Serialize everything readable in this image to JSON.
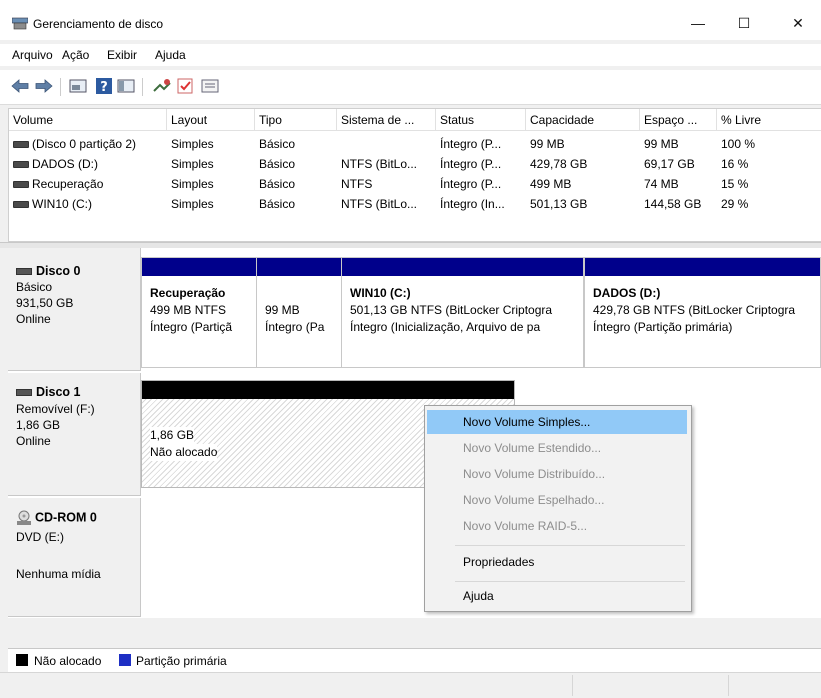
{
  "window": {
    "title": "Gerenciamento de disco",
    "minimize_glyph": "—",
    "maximize_glyph": "☐",
    "close_glyph": "✕"
  },
  "menu": [
    "Arquivo",
    "Ação",
    "Exibir",
    "Ajuda"
  ],
  "toolbar": {
    "icons": [
      "back-arrow-icon",
      "forward-arrow-icon",
      "disk-list-icon",
      "help-icon",
      "console-tree-icon",
      "connect-icon",
      "check-icon",
      "properties-icon"
    ]
  },
  "volume_table": {
    "columns": [
      "Volume",
      "Layout",
      "Tipo",
      "Sistema de ...",
      "Status",
      "Capacidade",
      "Espaço ...",
      "% Livre"
    ],
    "rows": [
      [
        "(Disco 0 partição 2)",
        "Simples",
        "Básico",
        "",
        "Íntegro (P...",
        "99 MB",
        "99 MB",
        "100 %"
      ],
      [
        "DADOS (D:)",
        "Simples",
        "Básico",
        "NTFS (BitLo...",
        "Íntegro (P...",
        "429,78 GB",
        "69,17 GB",
        "16 %"
      ],
      [
        "Recuperação",
        "Simples",
        "Básico",
        "NTFS",
        "Íntegro (P...",
        "499 MB",
        "74 MB",
        "15 %"
      ],
      [
        "WIN10 (C:)",
        "Simples",
        "Básico",
        "NTFS (BitLo...",
        "Íntegro (In...",
        "501,13 GB",
        "144,58 GB",
        "29 %"
      ]
    ]
  },
  "disk0": {
    "name": "Disco 0",
    "type": "Básico",
    "size": "931,50 GB",
    "status": "Online",
    "partitions": [
      {
        "title": "Recuperação",
        "line1": "499 MB NTFS",
        "line2": "Íntegro (Partiçã"
      },
      {
        "title": "",
        "line1": "99 MB",
        "line2": "Íntegro (Pa"
      },
      {
        "title": "WIN10  (C:)",
        "line1": "501,13 GB NTFS (BitLocker Criptogra",
        "line2": "Íntegro (Inicialização, Arquivo de pa"
      },
      {
        "title": "DADOS  (D:)",
        "line1": "429,78 GB NTFS (BitLocker Criptogra",
        "line2": "Íntegro (Partição primária)"
      }
    ]
  },
  "disk1": {
    "name": "Disco 1",
    "type": "Removível (F:)",
    "size": "1,86 GB",
    "status": "Online",
    "unallocated": {
      "line1": "1,86 GB",
      "line2": "Não alocado"
    }
  },
  "cdrom": {
    "name": "CD-ROM 0",
    "type": "DVD (E:)",
    "status": "Nenhuma mídia"
  },
  "context_menu": [
    {
      "label": "Novo Volume Simples...",
      "state": "selected"
    },
    {
      "label": "Novo Volume Estendido...",
      "state": "disabled"
    },
    {
      "label": "Novo Volume Distribuído...",
      "state": "disabled"
    },
    {
      "label": "Novo Volume Espelhado...",
      "state": "disabled"
    },
    {
      "label": "Novo Volume RAID-5...",
      "state": "disabled"
    },
    {
      "label": "Propriedades",
      "state": "enabled"
    },
    {
      "label": "Ajuda",
      "state": "enabled"
    }
  ],
  "legend": {
    "unallocated": {
      "label": "Não alocado",
      "color": "#000000"
    },
    "primary": {
      "label": "Partição primária",
      "color": "#1e2fc4"
    }
  },
  "colors": {
    "partition_bar": "#00008b",
    "unallocated_bar": "#000000",
    "selection": "#91c9f7"
  }
}
